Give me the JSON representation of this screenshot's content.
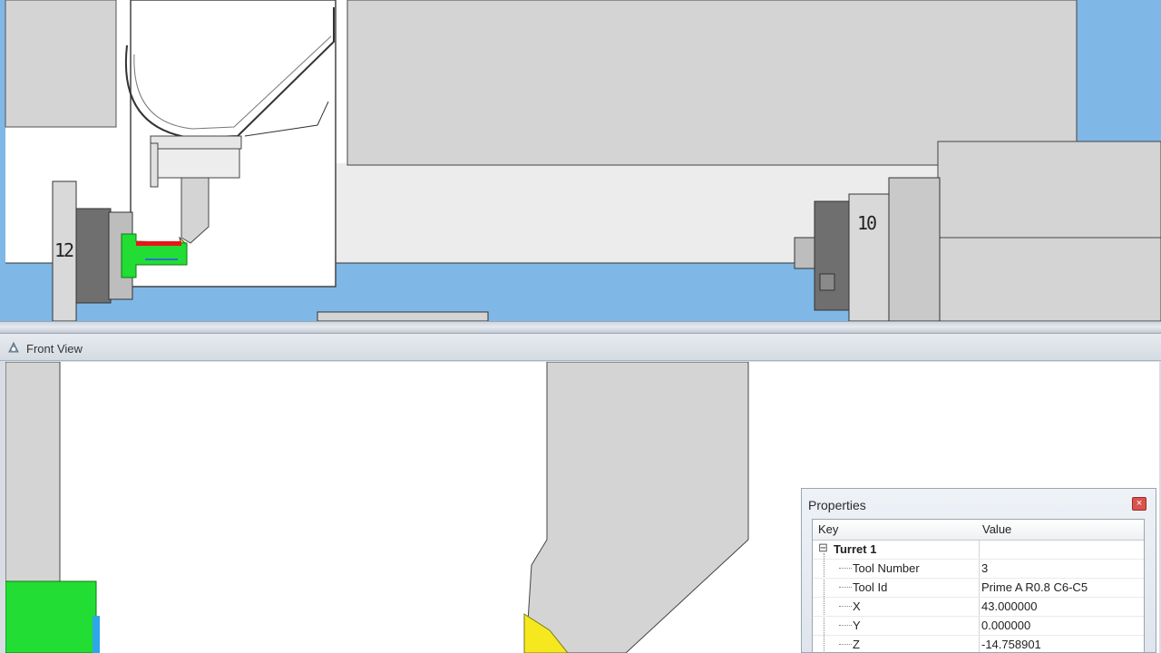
{
  "front_view": {
    "title": "Front View"
  },
  "top_view": {
    "turret_labels": [
      "12",
      "10"
    ]
  },
  "properties": {
    "title": "Properties",
    "close_label": "×",
    "columns": {
      "key": "Key",
      "value": "Value"
    },
    "group": {
      "expander": "⊟",
      "name": "Turret 1"
    },
    "rows": [
      {
        "key": "Tool Number",
        "value": "3"
      },
      {
        "key": "Tool Id",
        "value": "Prime A R0.8 C6-C5"
      },
      {
        "key": "X",
        "value": "43.000000"
      },
      {
        "key": "Y",
        "value": "0.000000"
      },
      {
        "key": "Z",
        "value": "-14.758901"
      }
    ]
  },
  "colors": {
    "coolant_blue": "#7fb8e6",
    "part_green": "#22dd33",
    "cut_red": "#e8151a",
    "insert_yellow": "#f5e81f",
    "machine_gray": "#d4d4d4"
  }
}
